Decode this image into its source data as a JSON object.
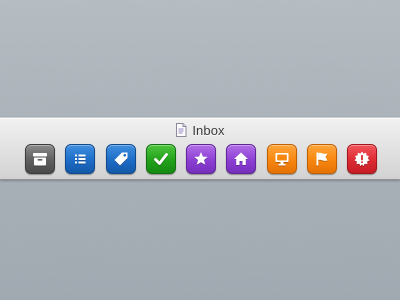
{
  "toolbar": {
    "title": "Inbox",
    "title_icon": "document-icon",
    "buttons": [
      {
        "icon": "archive-box-icon",
        "color": "#5f5f5f"
      },
      {
        "icon": "list-icon",
        "color": "#1d6cc6"
      },
      {
        "icon": "tag-icon",
        "color": "#1d6cc6"
      },
      {
        "icon": "checkmark-icon",
        "color": "#22a11b"
      },
      {
        "icon": "star-icon",
        "color": "#8c3fd3"
      },
      {
        "icon": "home-icon",
        "color": "#8c3fd3"
      },
      {
        "icon": "monitor-icon",
        "color": "#f7860f"
      },
      {
        "icon": "flag-icon",
        "color": "#f7860f"
      },
      {
        "icon": "alert-badge-icon",
        "color": "#dd2a33"
      }
    ]
  }
}
